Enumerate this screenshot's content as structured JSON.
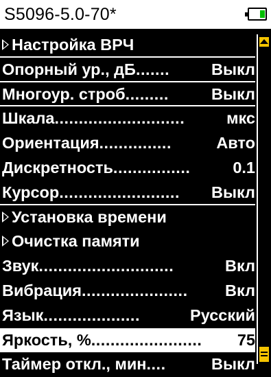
{
  "header": {
    "title": "S5096-5.0-70*",
    "battery_icon": "battery-icon",
    "battery_color": "#00c000"
  },
  "menu": {
    "items": [
      {
        "label": "Настройка ВРЧ",
        "submenu": true
      },
      {
        "label": "Опорный ур., дБ",
        "dots": ".......",
        "value": "Выкл"
      },
      {
        "label": "Многоур. строб",
        "dots": ".........",
        "value": "Выкл"
      },
      {
        "label": "Шкала",
        "dots": "...........................",
        "value": "мкс"
      },
      {
        "label": "Ориентация",
        "dots": "...............",
        "value": "Авто"
      },
      {
        "label": "Дискретность",
        "dots": "................",
        "value": "0.1"
      },
      {
        "label": "Курсор",
        "dots": ".........................",
        "value": "Выкл"
      },
      {
        "label": "Установка времени",
        "submenu": true
      },
      {
        "label": "Очистка памяти",
        "submenu": true
      },
      {
        "label": "Звук",
        "dots": "............................",
        "value": "Вкл"
      },
      {
        "label": "Вибрация",
        "dots": "......................",
        "value": "Вкл"
      },
      {
        "label": "Язык",
        "dots": "....................",
        "value": "Русский"
      },
      {
        "label": "Яркость, %",
        "dots": ".......................",
        "value": "75"
      },
      {
        "label": "Таймер откл., мин",
        "dots": "....",
        "value": "Выкл"
      }
    ]
  },
  "scrollbar": {
    "color": "#f5c400"
  }
}
